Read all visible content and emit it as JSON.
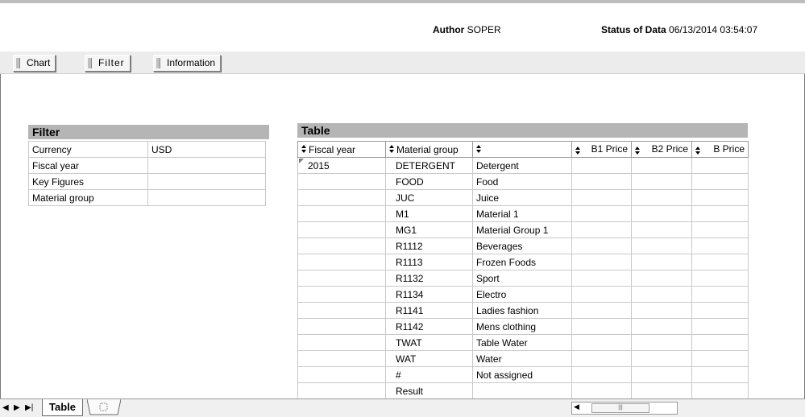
{
  "header": {
    "author_label": "Author",
    "author_value": "SOPER",
    "status_label": "Status of Data",
    "status_value": "06/13/2014 03:54:07"
  },
  "toolbar": {
    "tabs": [
      {
        "label": "Chart"
      },
      {
        "label": "Filter"
      },
      {
        "label": "Information"
      }
    ],
    "active": "Filter"
  },
  "filter": {
    "title": "Filter",
    "rows": [
      {
        "label": "Currency",
        "value": "USD"
      },
      {
        "label": "Fiscal year",
        "value": ""
      },
      {
        "label": "Key Figures",
        "value": ""
      },
      {
        "label": "Material group",
        "value": ""
      }
    ]
  },
  "table": {
    "title": "Table",
    "headers": [
      "Fiscal year",
      "Material group",
      "",
      "B1 Price",
      "B2 Price",
      "B Price"
    ],
    "fiscal_year": "2015",
    "rows": [
      {
        "code": "DETERGENT",
        "name": "Detergent"
      },
      {
        "code": "FOOD",
        "name": "Food"
      },
      {
        "code": "JUC",
        "name": "Juice"
      },
      {
        "code": "M1",
        "name": "Material 1"
      },
      {
        "code": "MG1",
        "name": "Material Group 1"
      },
      {
        "code": "R1112",
        "name": "Beverages"
      },
      {
        "code": "R1113",
        "name": "Frozen Foods"
      },
      {
        "code": "R1132",
        "name": "Sport"
      },
      {
        "code": "R1134",
        "name": "Electro"
      },
      {
        "code": "R1141",
        "name": "Ladies fashion"
      },
      {
        "code": "R1142",
        "name": "Mens clothing"
      },
      {
        "code": "TWAT",
        "name": "Table Water"
      },
      {
        "code": "WAT",
        "name": "Water"
      },
      {
        "code": "#",
        "name": "Not assigned"
      },
      {
        "code": "Result",
        "name": ""
      }
    ]
  },
  "sheetbar": {
    "active_sheet": "Table",
    "nav_prev_icon": "prev-sheet-icon",
    "nav_next_icon": "next-sheet-icon",
    "nav_last_icon": "last-sheet-icon",
    "new_sheet_icon": "new-sheet-icon"
  },
  "colors": {
    "panel_title_bg": "#b5b5b5",
    "toolbar_bg": "#ececec",
    "grid_border": "#c9c9c9"
  }
}
